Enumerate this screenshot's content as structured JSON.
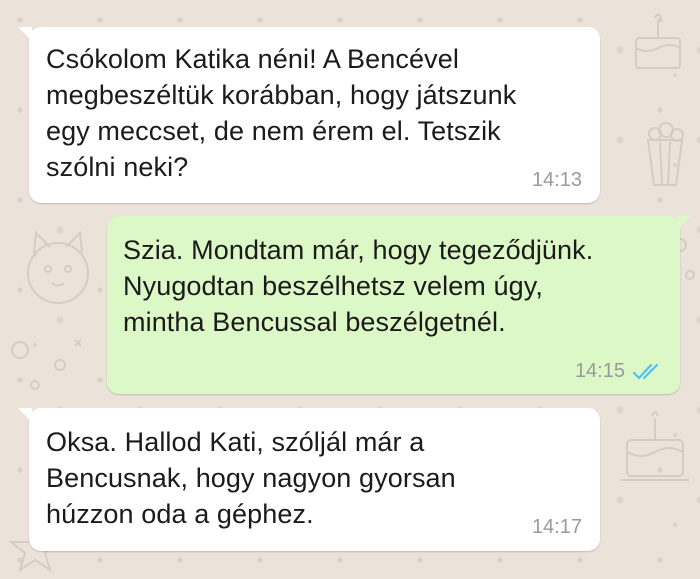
{
  "colors": {
    "incoming_bubble": "#ffffff",
    "outgoing_bubble": "#dcf8c6",
    "wallpaper": "#ebe3da",
    "read_ticks": "#4fc3f7",
    "timestamp": "#9a9a9a"
  },
  "messages": [
    {
      "direction": "incoming",
      "text": "Csókolom Katika néni! A Bencével\nmegbeszéltük korábban, hogy játszunk\negy meccset, de nem érem el. Tetszik\nszólni neki?",
      "time": "14:13"
    },
    {
      "direction": "outgoing",
      "text": "Szia. Mondtam már, hogy tegeződjünk.\nNyugodtan beszélhetsz velem úgy,\nmintha Bencussal beszélgetnél.",
      "time": "14:15",
      "status_icon": "double-check-read-icon"
    },
    {
      "direction": "incoming",
      "text": "Oksa. Hallod Kati, szóljál már a\nBencusnak, hogy nagyon gyorsan\nhúzzon oda a géphez.",
      "time": "14:17"
    }
  ]
}
